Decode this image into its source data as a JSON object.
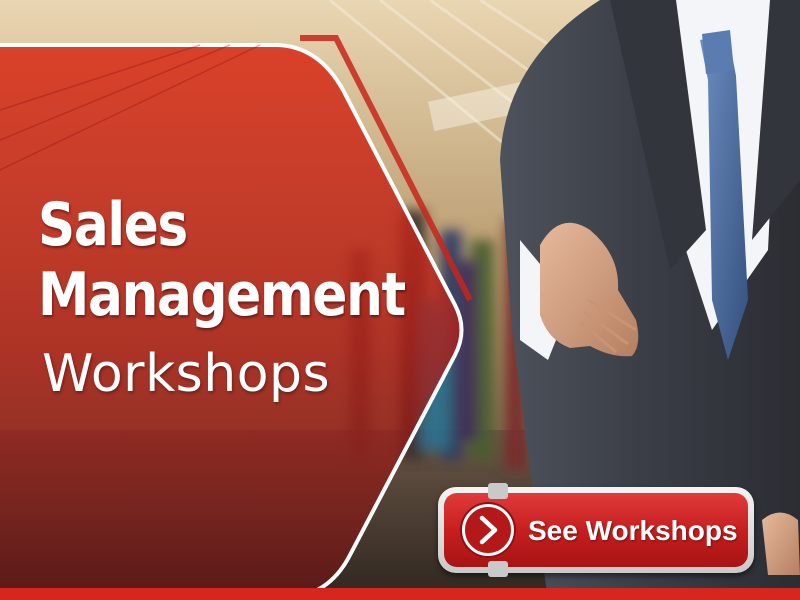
{
  "banner": {
    "title_line1": "Sales",
    "title_line2": "Management",
    "subtitle": "Workshops",
    "cta_label": "See Workshops"
  },
  "icons": {
    "cta": "chevron-right-icon"
  },
  "colors": {
    "accent_red": "#c41d1d",
    "frame_white": "#ffffff",
    "suit_dark": "#3a3d45",
    "tie_blue": "#4a6a9c"
  }
}
